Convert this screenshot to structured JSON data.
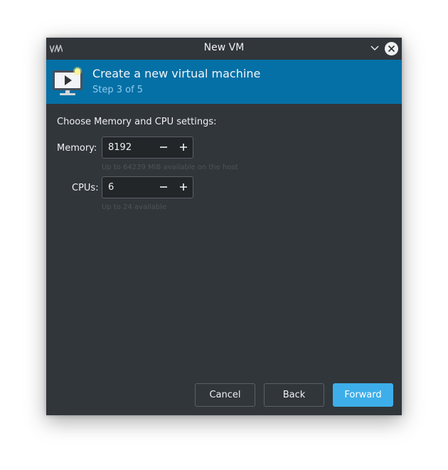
{
  "window": {
    "title": "New VM",
    "title_icon": "virt-manager-logo-icon",
    "minimize_icon": "chevron-down-icon",
    "close_icon": "close-icon"
  },
  "banner": {
    "icon": "virtual-machine-screen-icon",
    "title": "Create a new virtual machine",
    "step": "Step 3 of 5"
  },
  "settings": {
    "heading": "Choose Memory and CPU settings:",
    "memory": {
      "label": "Memory:",
      "value": "8192",
      "hint": "Up to 64239 MiB available on the host",
      "decrement_icon": "minus-icon",
      "increment_icon": "plus-icon"
    },
    "cpus": {
      "label": "CPUs:",
      "value": "6",
      "hint": "Up to 24 available",
      "decrement_icon": "minus-icon",
      "increment_icon": "plus-icon"
    }
  },
  "buttons": {
    "cancel": "Cancel",
    "back": "Back",
    "forward": "Forward"
  },
  "colors": {
    "window_bg": "#31363b",
    "banner_bg": "#0570a6",
    "accent": "#3daee9",
    "text": "#eff0f1",
    "hint_text": "#4e5358"
  }
}
